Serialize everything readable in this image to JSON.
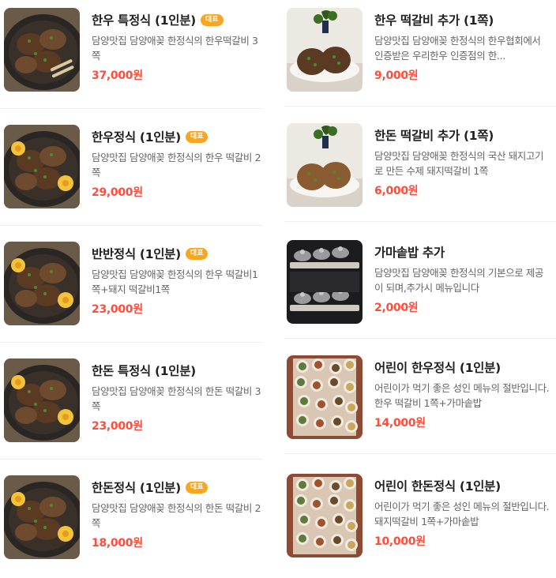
{
  "menu": {
    "badge_label": "대표",
    "items": [
      {
        "name": "한우 특정식 (1인분)",
        "badge": true,
        "desc": "담양맛집 담양애꽂 한정식의 한우떡갈비 3쪽",
        "price": "37,000원",
        "image": "hanwoo-tteokgalbi-photo"
      },
      {
        "name": "한우 떡갈비 추가 (1쪽)",
        "badge": false,
        "desc": "담양맛집 담양애꽂 한정식의 한우협회에서 인증받은 우리한우 인증점의 한...",
        "price": "9,000원",
        "image": "hanwoo-patty-plate-photo"
      },
      {
        "name": "한우정식 (1인분)",
        "badge": true,
        "desc": "담양맛집 담양애꽂 한정식의 한우 떡갈비 2쪽",
        "price": "29,000원",
        "image": "hanwoo-set-photo"
      },
      {
        "name": "한돈 떡갈비 추가 (1쪽)",
        "badge": false,
        "desc": "담양맛집 담양애꽂 한정식의 국산 돼지고기로 만든 수제 돼지떡갈비 1쪽",
        "price": "6,000원",
        "image": "pork-patty-plate-photo"
      },
      {
        "name": "반반정식 (1인분)",
        "badge": true,
        "desc": "담양맛집 담양애꽂 한정식의 한우 떡갈비1쪽+돼지 떡갈비1쪽",
        "price": "23,000원",
        "image": "half-half-set-photo"
      },
      {
        "name": "가마솥밥 추가",
        "badge": false,
        "desc": "담양맛집 담양애꽂 한정식의 기본으로 제공이 되며,추가시 메뉴입니다",
        "price": "2,000원",
        "image": "pot-rice-photo"
      },
      {
        "name": "한돈 특정식 (1인분)",
        "badge": false,
        "desc": "담양맛집 담양애꽂 한정식의 한돈 떡갈비 3쪽",
        "price": "23,000원",
        "image": "pork-special-set-photo"
      },
      {
        "name": "어린이 한우정식 (1인분)",
        "badge": false,
        "desc": "어린이가 먹기 좋은 성인 메뉴의 절반입니다. 한우 떡갈비 1쪽+가마솥밥",
        "price": "14,000원",
        "image": "kids-hanwoo-table-photo"
      },
      {
        "name": "한돈정식 (1인분)",
        "badge": true,
        "desc": "담양맛집 담양애꽂 한정식의 한돈 떡갈비 2쪽",
        "price": "18,000원",
        "image": "pork-set-photo"
      },
      {
        "name": "어린이 한돈정식 (1인분)",
        "badge": false,
        "desc": "어린이가 먹기 좋은 성인 메뉴의 절반입니다. 돼지떡갈비 1쪽+가마솥밥",
        "price": "10,000원",
        "image": "kids-pork-table-photo"
      }
    ]
  }
}
